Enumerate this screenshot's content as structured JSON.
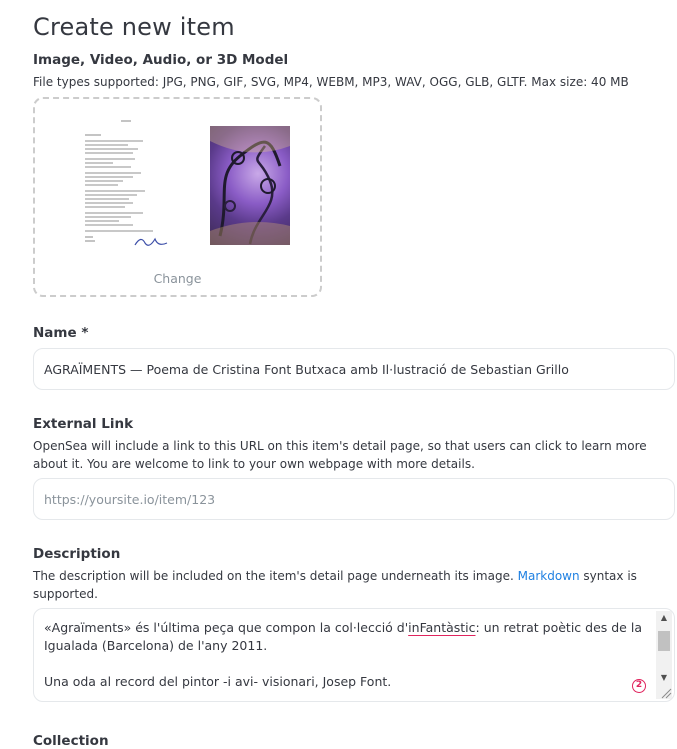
{
  "page": {
    "title": "Create new item"
  },
  "media": {
    "label": "Image, Video, Audio, or 3D Model",
    "help": "File types supported: JPG, PNG, GIF, SVG, MP4, WEBM, MP3, WAV, OGG, GLB, GLTF. Max size: 40 MB",
    "change_label": "Change"
  },
  "name": {
    "label": "Name *",
    "value": "AGRAÏMENTS — Poema de Cristina Font Butxaca amb Il·lustració de Sebastian Grillo"
  },
  "external_link": {
    "label": "External Link",
    "help": "OpenSea will include a link to this URL on this item's detail page, so that users can click to learn more about it. You are welcome to link to your own webpage with more details.",
    "placeholder": "https://yoursite.io/item/123"
  },
  "description": {
    "label": "Description",
    "help_before": "The description will be included on the item's detail page underneath its image. ",
    "help_link": "Markdown",
    "help_after": " syntax is supported.",
    "line1_before": "«Agraïments» és l'última peça que compon la col·lecció d'",
    "line1_spell": "inFantàstic",
    "line1_after": ": un retrat poètic des de la Igualada (Barcelona) de l'any 2011.",
    "line2": "Una oda al record del pintor -i avi- visionari, Josep Font.",
    "badge_count": "2"
  },
  "collection": {
    "label": "Collection"
  },
  "colors": {
    "accent": "#2081e2",
    "error": "#e0245e",
    "border": "#e5e8eb",
    "muted": "#8a939b"
  }
}
